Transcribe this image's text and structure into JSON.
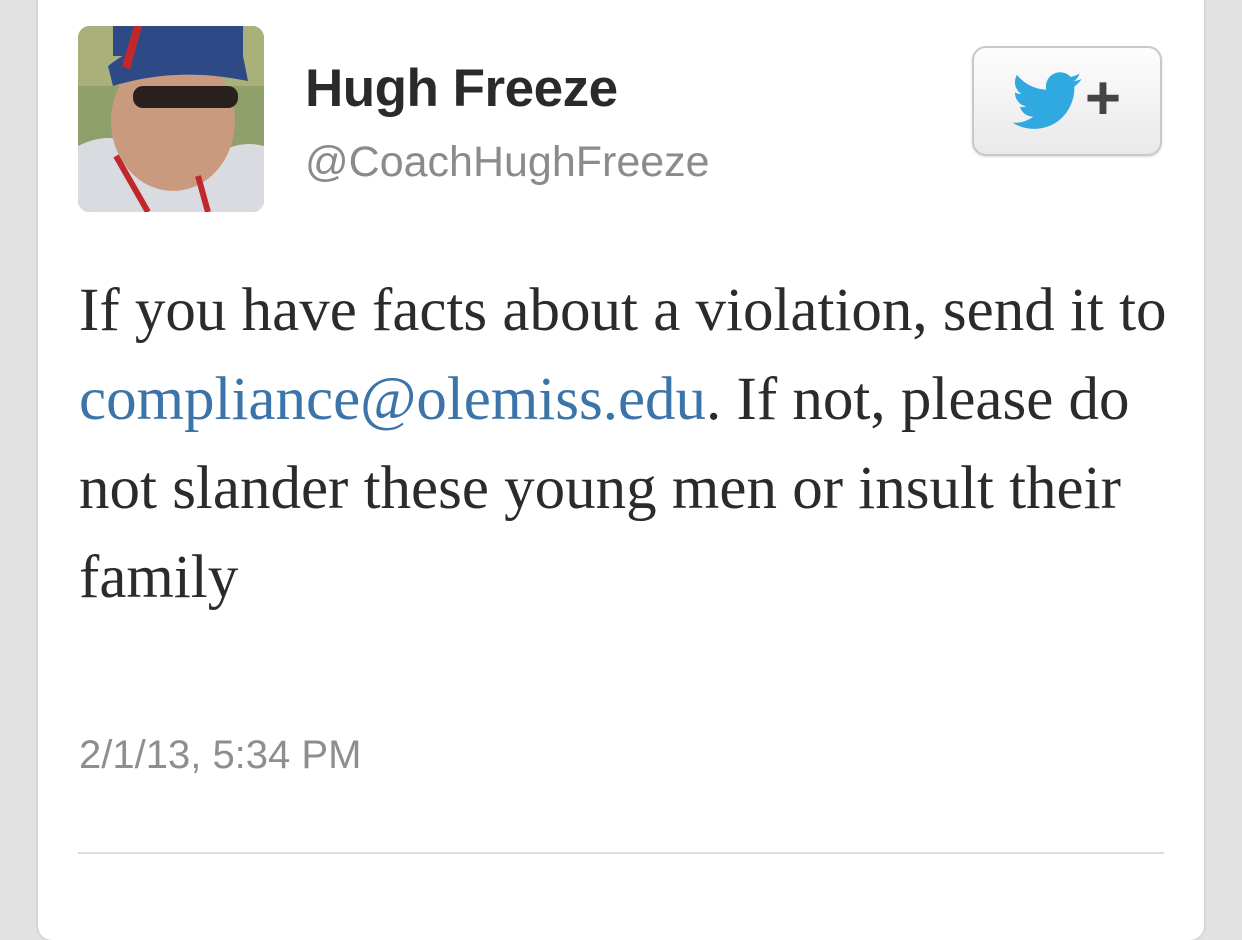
{
  "tweet": {
    "display_name": "Hugh Freeze",
    "handle": "@CoachHughFreeze",
    "text_before_link": "If you have facts about a violation, send it to ",
    "link": "compliance@olemiss.edu",
    "text_after_link": ". If not, please do not slander these young men or insult their family",
    "timestamp": "2/1/13, 5:34 PM"
  },
  "follow_button": {
    "icon": "twitter-bird-icon",
    "plus": "+"
  },
  "colors": {
    "link": "#3b74a8",
    "twitter_blue": "#2fa9e0",
    "name": "#2a2a2a",
    "meta": "#8b8b8b"
  }
}
